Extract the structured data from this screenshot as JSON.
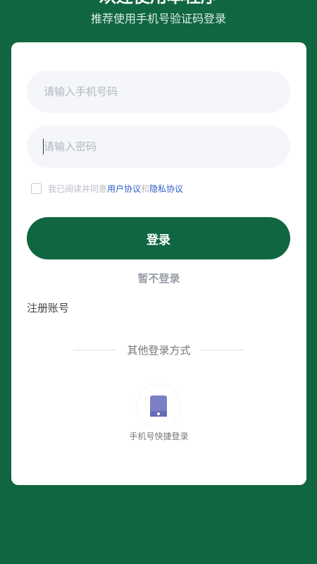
{
  "header": {
    "welcome": "欢迎使用本程序",
    "subtitle": "推荐使用手机号验证码登录"
  },
  "form": {
    "phone_placeholder": "请输入手机号码",
    "password_placeholder": "请输入密码",
    "agree_prefix": "我已阅读并同意",
    "user_agreement": "用户协议",
    "and": "和",
    "privacy_policy": "隐私协议",
    "login_label": "登录",
    "skip_label": "暂不登录",
    "register_label": "注册账号"
  },
  "other_login": {
    "title": "其他登录方式",
    "phone_quick_label": "手机号快捷登录",
    "icon": "phone-icon"
  },
  "colors": {
    "brand_green": "#0f6641",
    "link_blue": "#2f5fc2",
    "phone_icon": "#7b80c4"
  }
}
